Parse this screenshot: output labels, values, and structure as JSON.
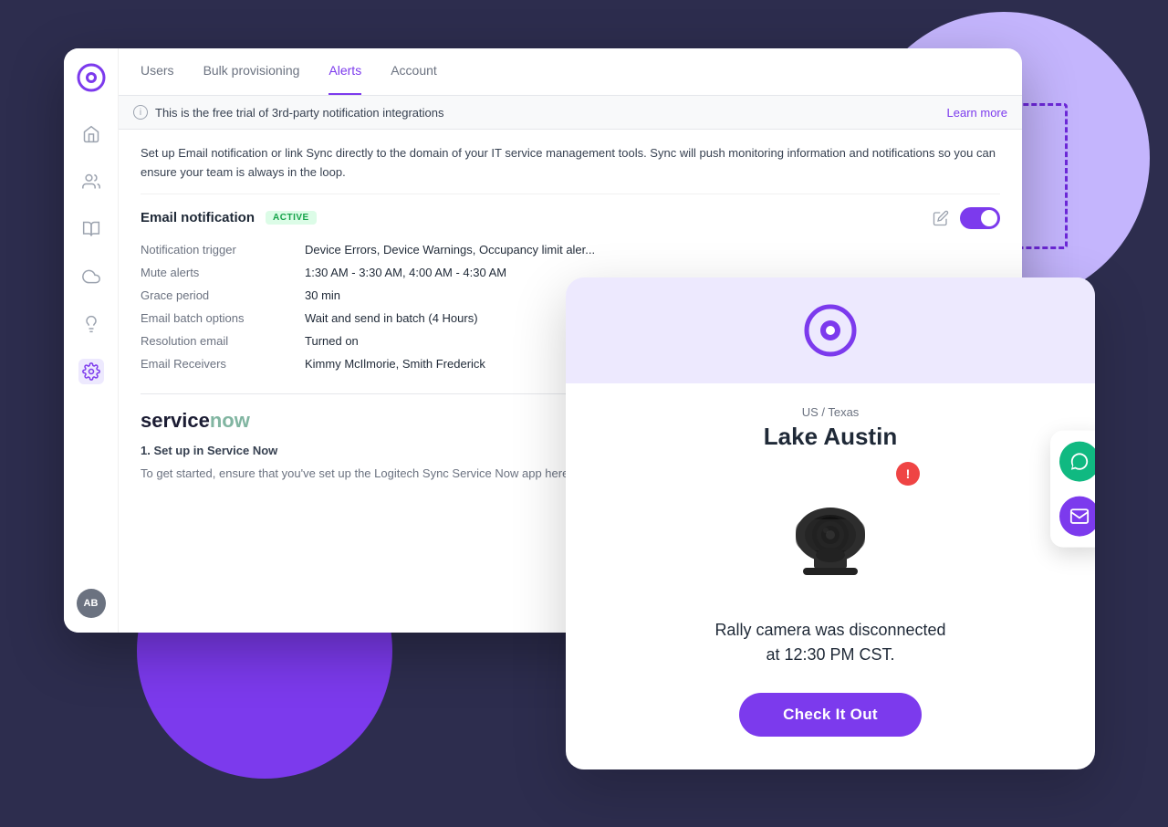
{
  "app": {
    "title": "Logitech Sync",
    "logo_initials": "AB"
  },
  "sidebar": {
    "items": [
      {
        "name": "home",
        "icon": "home",
        "active": false
      },
      {
        "name": "contacts",
        "icon": "contacts",
        "active": false
      },
      {
        "name": "book",
        "icon": "book",
        "active": false
      },
      {
        "name": "cloud",
        "icon": "cloud",
        "active": false
      },
      {
        "name": "lightbulb",
        "icon": "lightbulb",
        "active": false
      },
      {
        "name": "settings",
        "icon": "settings",
        "active": true
      }
    ]
  },
  "nav": {
    "tabs": [
      {
        "label": "Users",
        "active": false
      },
      {
        "label": "Bulk provisioning",
        "active": false
      },
      {
        "label": "Alerts",
        "active": true
      },
      {
        "label": "Account",
        "active": false
      }
    ]
  },
  "info_banner": {
    "text": "This is the free trial of 3rd-party notification integrations",
    "learn_more": "Learn more"
  },
  "description": "Set up Email notification or link Sync directly to the domain of your IT service management tools. Sync will push monitoring information and notifications so you can ensure your team is always in the loop.",
  "email_section": {
    "title": "Email notification",
    "badge": "ACTIVE",
    "rows": [
      {
        "label": "Notification trigger",
        "value": "Device Errors, Device Warnings, Occupancy limit aler..."
      },
      {
        "label": "Mute alerts",
        "value": "1:30 AM - 3:30 AM, 4:00 AM - 4:30 AM"
      },
      {
        "label": "Grace period",
        "value": "30 min"
      },
      {
        "label": "Email batch options",
        "value": "Wait and send in batch (4 Hours)"
      },
      {
        "label": "Resolution email",
        "value": "Turned on"
      },
      {
        "label": "Email Receivers",
        "value": "Kimmy McIlmorie, Smith Frederick"
      }
    ]
  },
  "servicenow": {
    "logo": "servicenow",
    "step": "1. Set up in Service Now",
    "description": "To get started, ensure that you've set up the Logitech Sync Service Now app here."
  },
  "notification_card": {
    "location": "US / Texas",
    "room_name": "Lake Austin",
    "message_line1": "Rally camera was disconnected",
    "message_line2": "at 12:30 PM CST.",
    "button_label": "Check It Out"
  },
  "side_icons": {
    "chat_label": "chat",
    "email_label": "email"
  }
}
